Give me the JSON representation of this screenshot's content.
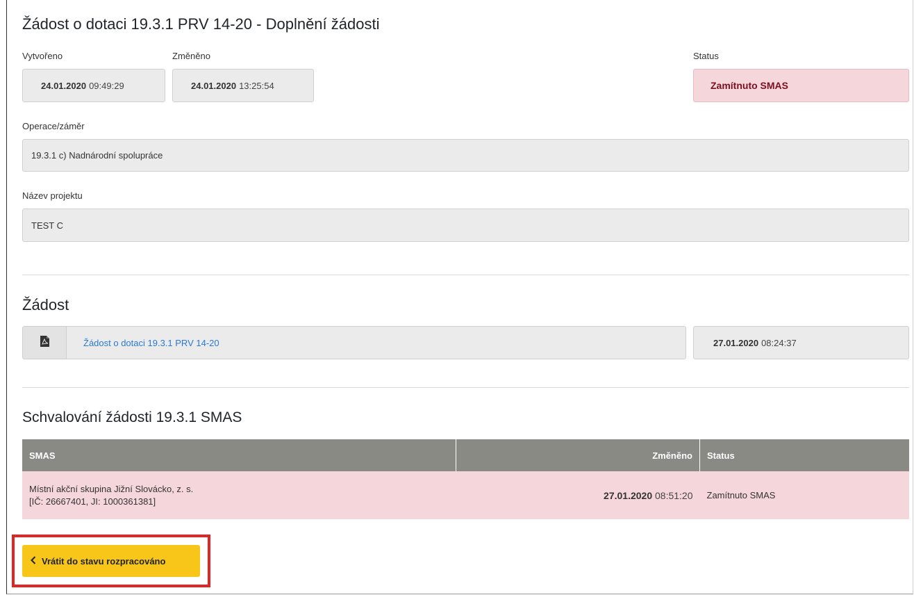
{
  "header": {
    "title": "Žádost o dotaci 19.3.1 PRV 14-20 - Doplnění žádosti"
  },
  "meta": {
    "created_label": "Vytvořeno",
    "created_date": "24.01.2020",
    "created_time": "09:49:29",
    "changed_label": "Změněno",
    "changed_date": "24.01.2020",
    "changed_time": "13:25:54",
    "status_label": "Status",
    "status_value": "Zamítnuto SMAS"
  },
  "operation": {
    "label": "Operace/záměr",
    "value": "19.3.1 c) Nadnárodní spolupráce"
  },
  "project": {
    "label": "Název projektu",
    "value": "TEST C"
  },
  "application": {
    "section_title": "Žádost",
    "document_link": "Žádost o dotaci 19.3.1 PRV 14-20",
    "document_icon": "pdf-file-icon",
    "date": "27.01.2020",
    "time": "08:24:37"
  },
  "approval": {
    "section_title": "Schvalování žádosti 19.3.1 SMAS",
    "columns": [
      "SMAS",
      "Změněno",
      "Status"
    ],
    "rows": [
      {
        "name": "Místní akční skupina Jižní Slovácko, z. s.",
        "ids": "[IČ: 26667401, JI: 1000361381]",
        "date": "27.01.2020",
        "time": "08:51:20",
        "status": "Zamítnuto SMAS"
      }
    ]
  },
  "actions": {
    "return_button_label": "Vrátit do stavu rozpracováno",
    "return_button_icon": "chevron-left-icon"
  },
  "colors": {
    "status_background": "#f5d6da",
    "table_header": "#8a8a84",
    "button": "#f7c619",
    "highlight_border": "#e32424",
    "link": "#2a7ad2"
  }
}
